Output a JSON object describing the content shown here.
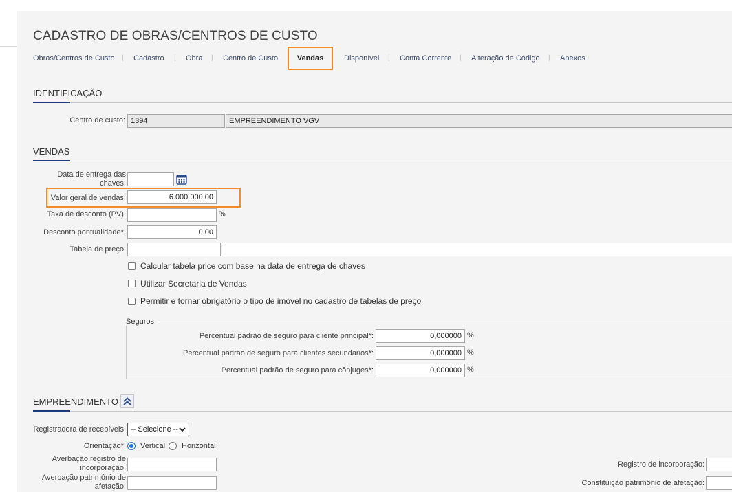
{
  "page": {
    "title": "CADASTRO DE OBRAS/CENTROS DE CUSTO"
  },
  "tabs": [
    {
      "label": "Obras/Centros de Custo"
    },
    {
      "label": "Cadastro"
    },
    {
      "label": "Obra"
    },
    {
      "label": "Centro de Custo"
    },
    {
      "label": "Vendas",
      "active": true
    },
    {
      "label": "Disponível"
    },
    {
      "label": "Conta Corrente"
    },
    {
      "label": "Alteração de Código"
    },
    {
      "label": "Anexos"
    }
  ],
  "identificacao": {
    "heading": "IDENTIFICAÇÃO",
    "centro_label": "Centro de custo:",
    "centro_code": "1394",
    "centro_name": "EMPREENDIMENTO VGV"
  },
  "vendas": {
    "heading": "VENDAS",
    "entrega_label": "Data de entrega das chaves:",
    "entrega_value": "",
    "valor_label": "Valor geral de vendas:",
    "valor_value": "6.000.000,00",
    "taxa_label": "Taxa de desconto (PV):",
    "taxa_value": "",
    "taxa_unit": "%",
    "desconto_label": "Desconto pontualidade*:",
    "desconto_value": "0,00",
    "tabela_label": "Tabela de preço:",
    "tabela_code": "",
    "tabela_desc": "",
    "checkboxes": [
      {
        "label": "Calcular tabela price com base na data de entrega de chaves",
        "checked": false
      },
      {
        "label": "Utilizar Secretaria de Vendas",
        "checked": false
      },
      {
        "label": "Permitir e tornar obrigatório o tipo de imóvel no cadastro de tabelas de preço",
        "checked": false
      }
    ]
  },
  "seguros": {
    "legend": "Seguros",
    "rows": [
      {
        "label": "Percentual padrão de seguro para cliente principal*:",
        "value": "0,000000",
        "unit": "%"
      },
      {
        "label": "Percentual padrão de seguro para clientes secundários*:",
        "value": "0,000000",
        "unit": "%"
      },
      {
        "label": "Percentual padrão de seguro para cônjuges*:",
        "value": "0,000000",
        "unit": "%"
      }
    ]
  },
  "empreendimento": {
    "heading": "EMPREENDIMENTO",
    "registradora_label": "Registradora de recebíveis:",
    "registradora_value": "-- Selecione --",
    "orientacao_label": "Orientação*:",
    "orientacao_options": [
      "Vertical",
      "Horizontal"
    ],
    "orientacao_selected": "Vertical",
    "averbacao_registro_label": "Averbação registro de incorporação:",
    "averbacao_patrimonio_label": "Averbação patrimônio de afetação:",
    "registro_incorporacao_label": "Registro de incorporação:",
    "constituicao_label": "Constituição patrimônio de afetação:"
  },
  "colors": {
    "highlight": "#f28c28",
    "accent": "#1f3a7a",
    "link": "#3a4a6b",
    "radio": "#1a73e8"
  }
}
